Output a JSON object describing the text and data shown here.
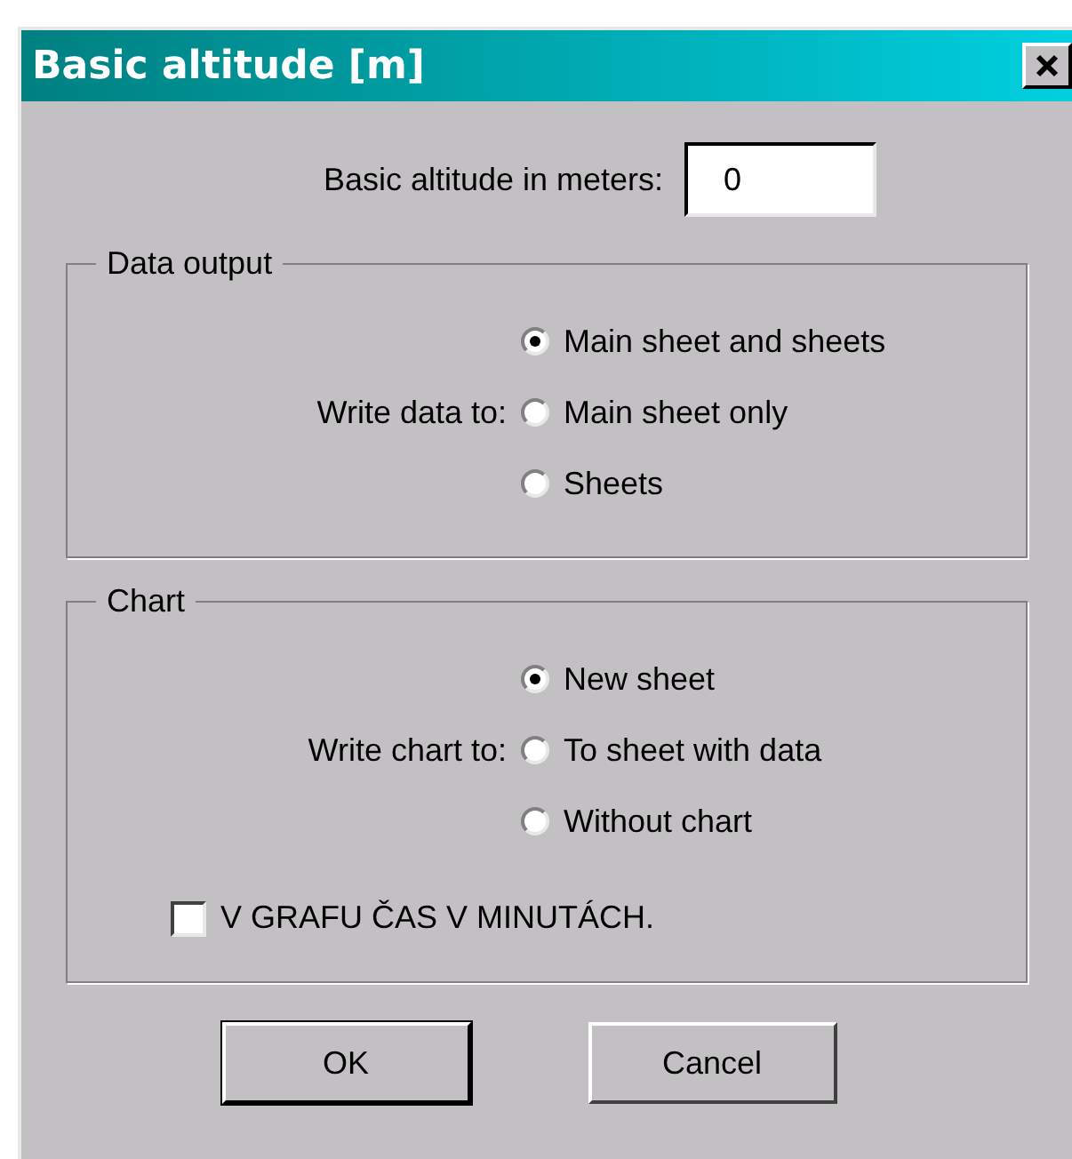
{
  "window": {
    "title": "Basic altitude [m]"
  },
  "altitude": {
    "label": "Basic altitude in meters:",
    "value": "0"
  },
  "groups": [
    {
      "title": "Data output",
      "label": "Write data to:",
      "options": [
        {
          "label": "Main sheet and sheets",
          "selected": true
        },
        {
          "label": "Main sheet only",
          "selected": false
        },
        {
          "label": "Sheets",
          "selected": false
        }
      ]
    },
    {
      "title": "Chart",
      "label": "Write chart to:",
      "options": [
        {
          "label": "New sheet",
          "selected": true
        },
        {
          "label": "To sheet with data",
          "selected": false
        },
        {
          "label": "Without chart",
          "selected": false
        }
      ],
      "checkbox": {
        "label": "V GRAFU ČAS V MINUTÁCH.",
        "checked": false
      }
    }
  ],
  "buttons": [
    {
      "label": "OK",
      "default": true
    },
    {
      "label": "Cancel",
      "default": false
    }
  ]
}
